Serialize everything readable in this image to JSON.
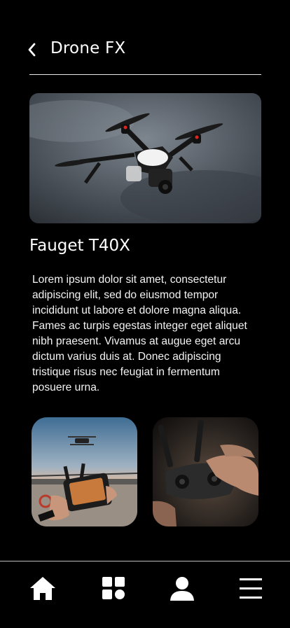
{
  "header": {
    "title": "Drone FX",
    "back_icon": "chevron-left-icon"
  },
  "product": {
    "name": "Fauget T40X",
    "description": "Lorem ipsum dolor sit amet, consectetur adipiscing elit, sed do eiusmod tempor incididunt ut labore et dolore magna aliqua. Fames ac turpis egestas integer eget aliquet nibh praesent. Vivamus at augue eget arcu dictum varius duis at. Donec adipiscing tristique risus nec feugiat in fermentum posuere urna."
  },
  "gallery": {
    "items": [
      {
        "subject": "drone-over-pier-with-controller-photo"
      },
      {
        "subject": "hands-holding-remote-controller-photo"
      }
    ]
  },
  "bottom_nav": {
    "items": [
      {
        "icon": "home-icon"
      },
      {
        "icon": "grid-icon"
      },
      {
        "icon": "user-icon"
      },
      {
        "icon": "menu-icon"
      }
    ]
  },
  "colors": {
    "background": "#000000",
    "text": "#ffffff",
    "divider": "#e8e8e8"
  }
}
